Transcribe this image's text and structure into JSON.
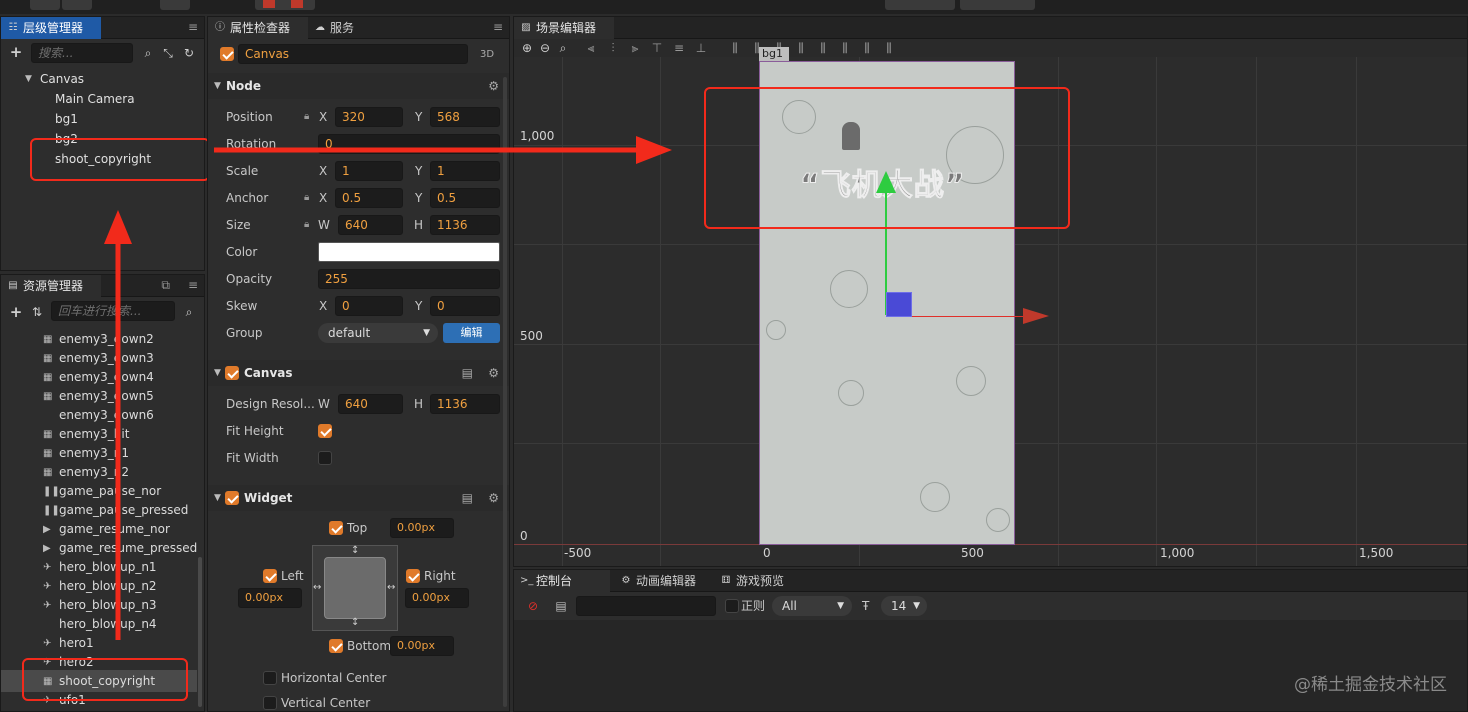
{
  "hierarchy": {
    "tab": "层级管理器",
    "search_placeholder": "搜索...",
    "items": [
      "Canvas",
      "Main Camera",
      "bg1",
      "bg2",
      "shoot_copyright"
    ]
  },
  "assets": {
    "tab": "资源管理器",
    "search_placeholder": "回车进行搜索...",
    "items": [
      "enemy3_down2",
      "enemy3_down3",
      "enemy3_down4",
      "enemy3_down5",
      "enemy3_down6",
      "enemy3_hit",
      "enemy3_n1",
      "enemy3_n2",
      "game_pause_nor",
      "game_pause_pressed",
      "game_resume_nor",
      "game_resume_pressed",
      "hero_blowup_n1",
      "hero_blowup_n2",
      "hero_blowup_n3",
      "hero_blowup_n4",
      "hero1",
      "hero2",
      "shoot_copyright",
      "ufo1"
    ]
  },
  "inspector": {
    "tab": "属性检查器",
    "tab2": "服务",
    "node_name": "Canvas",
    "mode_3d": "3D",
    "node_section": "Node",
    "position_label": "Position",
    "pos_x": "320",
    "pos_y": "568",
    "rotation_label": "Rotation",
    "rotation": "0",
    "scale_label": "Scale",
    "scale_x": "1",
    "scale_y": "1",
    "anchor_label": "Anchor",
    "anchor_x": "0.5",
    "anchor_y": "0.5",
    "size_label": "Size",
    "size_w": "640",
    "size_h": "1136",
    "color_label": "Color",
    "opacity_label": "Opacity",
    "opacity": "255",
    "skew_label": "Skew",
    "skew_x": "0",
    "skew_y": "0",
    "group_label": "Group",
    "group": "default",
    "edit_btn": "编辑",
    "x": "X",
    "y": "Y",
    "w": "W",
    "h": "H",
    "canvas_section": "Canvas",
    "design_label": "Design Resol...",
    "design_w": "640",
    "design_h": "1136",
    "fit_height": "Fit Height",
    "fit_width": "Fit Width",
    "widget_section": "Widget",
    "top": "Top",
    "top_val": "0.00px",
    "left": "Left",
    "left_val": "0.00px",
    "right": "Right",
    "right_val": "0.00px",
    "bottom": "Bottom",
    "bottom_val": "0.00px",
    "hcenter": "Horizontal Center",
    "vcenter": "Vertical Center"
  },
  "scene": {
    "tab": "场景编辑器",
    "node_tag": "bg1",
    "title_text": "“飞机大战”",
    "y_labels": [
      "1,000",
      "500",
      "0"
    ],
    "x_labels": [
      "-500",
      "0",
      "500",
      "1,000",
      "1,500"
    ]
  },
  "console": {
    "tab1": "控制台",
    "tab2": "动画编辑器",
    "tab3": "游戏预览",
    "regex": "正则",
    "level": "All",
    "font_size": "14"
  },
  "watermark": "@稀土掘金技术社区",
  "colors": {
    "accent": "#e07a2a",
    "highlight": "#f22a1b",
    "tab_blue": "#1f5aa6",
    "value_orange": "#f0a040"
  }
}
